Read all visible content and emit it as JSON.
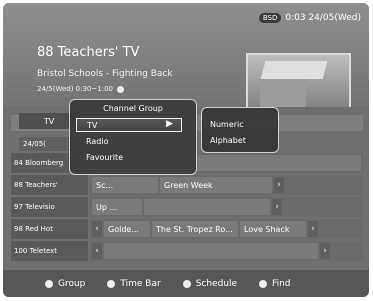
{
  "header": {
    "badge": "BSD",
    "clock": "0:03 24/05(Wed)",
    "channel_title": "88 Teachers' TV",
    "program_title": "Bristol Schools - Fighting Back",
    "program_time": "24/5(Wed) 0:30~1:00"
  },
  "guide": {
    "tab_label": "TV",
    "date_label": "24/05(",
    "channels": [
      {
        "num_name": "84 Bloomberg",
        "programs": [
          "",
          ""
        ]
      },
      {
        "num_name": "88 Teachers'",
        "programs": [
          "Sc...",
          "Green Week"
        ]
      },
      {
        "num_name": "97 Televisio",
        "programs": [
          "Up ...",
          ""
        ]
      },
      {
        "num_name": "98 Red Hot",
        "programs": [
          "Golde...",
          "The St. Tropez Ro...",
          "Love Shack"
        ]
      },
      {
        "num_name": "100 Teletext",
        "programs": []
      }
    ]
  },
  "menu": {
    "title": "Channel Group",
    "items": [
      "TV",
      "Radio",
      "Favourite"
    ],
    "submenu": [
      "Numeric",
      "Alphabet"
    ]
  },
  "footer": {
    "buttons": [
      "Group",
      "Time Bar",
      "Schedule",
      "Find"
    ]
  },
  "colors": {
    "highlight_border": "#eeeeee"
  }
}
